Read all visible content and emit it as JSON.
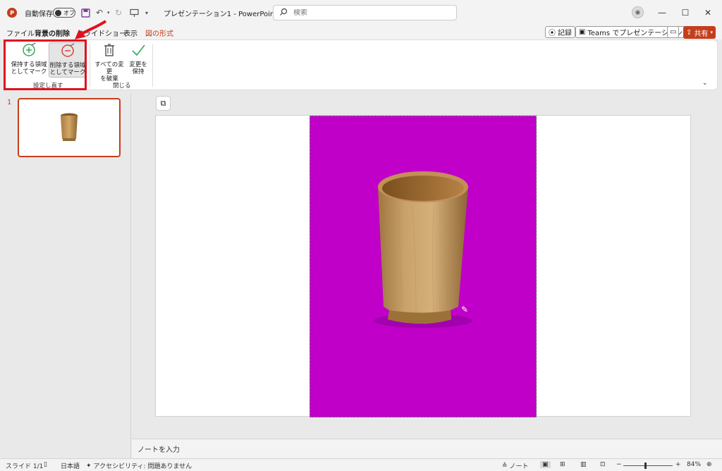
{
  "titlebar": {
    "autosave_label": "自動保存",
    "autosave_state": "オフ",
    "doc_title": "プレゼンテーション1  -  PowerPoint",
    "search_placeholder": "検索"
  },
  "tabs": {
    "file": "ファイル",
    "bg_remove": "背景の削除",
    "slideshow": "スライドショー",
    "view": "表示",
    "picture_format": "図の形式"
  },
  "right_buttons": {
    "record": "記録",
    "teams": "Teams でプレゼンテーション",
    "share": "共有"
  },
  "ribbon": {
    "keep_mark": [
      "保持する領域",
      "としてマーク"
    ],
    "remove_mark": [
      "削除する領域",
      "としてマーク"
    ],
    "discard_all": [
      "すべての変更",
      "を破棄"
    ],
    "keep_changes": [
      "変更を",
      "保持"
    ],
    "group_refine": "設定し直す",
    "group_close": "閉じる"
  },
  "thumbs": {
    "slide_number": "1"
  },
  "notes": {
    "placeholder": "ノートを入力"
  },
  "status": {
    "slide": "スライド 1/1",
    "language": "日本語",
    "accessibility": "アクセシビリティ: 問題ありません",
    "notes_button": "ノート",
    "zoom": "84%"
  },
  "colors": {
    "accent": "#c43e1c",
    "background_removal": "#c000c8",
    "highlight": "#e0121e"
  }
}
